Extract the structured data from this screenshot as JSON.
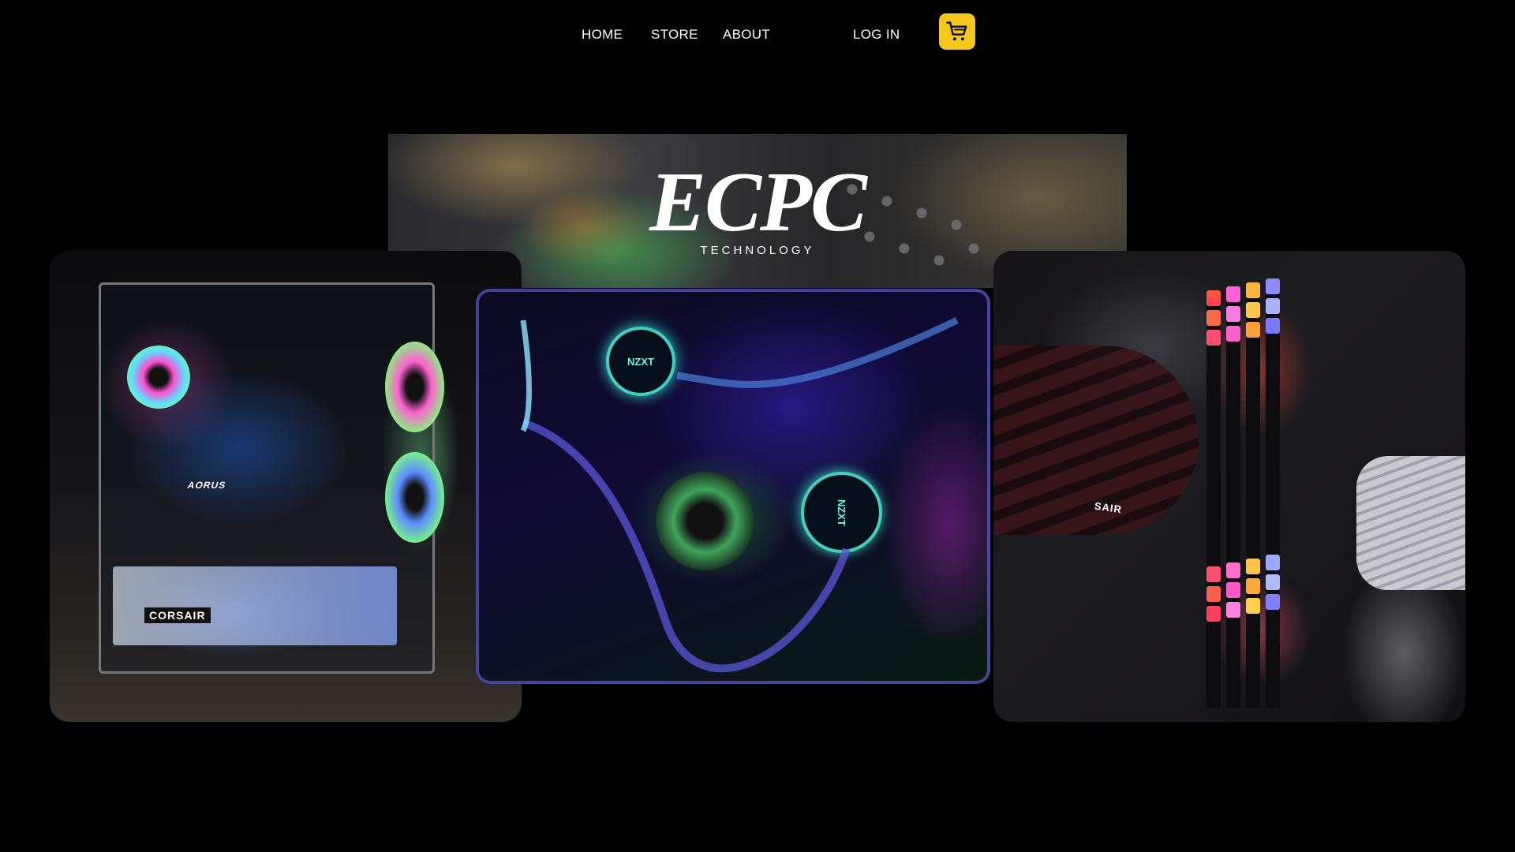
{
  "nav": {
    "home_label": "HOME",
    "store_label": "STORE",
    "about_label": "ABOUT",
    "login_label": "LOG IN",
    "cart_icon": "cart-icon",
    "cart_color": "#f7c81c"
  },
  "hero": {
    "logo_text": "ECPC",
    "tagline": "TECHNOLOGY"
  },
  "gallery": {
    "left": {
      "brand_badge": "CORSAIR",
      "gpu_brand": "AORUS"
    },
    "center": {
      "cooler_top": "NZXT",
      "cooler_bottom": "NZXT"
    },
    "right": {
      "cable_brand": "SAIR"
    }
  }
}
